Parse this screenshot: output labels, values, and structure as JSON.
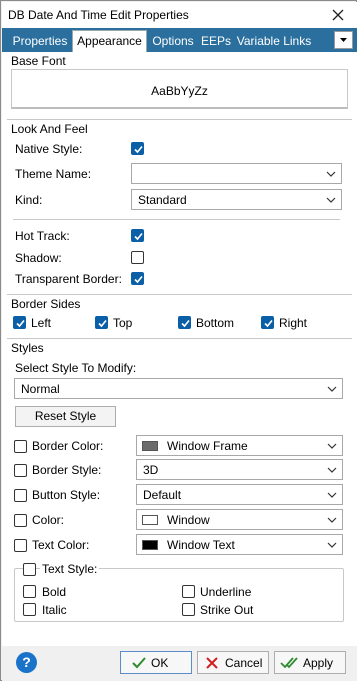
{
  "window": {
    "title": "DB Date And Time Edit Properties"
  },
  "tabs": [
    "Properties",
    "Appearance",
    "Options",
    "EEPs",
    "Variable Links"
  ],
  "base_font": {
    "title": "Base Font",
    "sample": "AaBbYyZz"
  },
  "look_and_feel": {
    "title": "Look And Feel",
    "native_style_label": "Native Style:",
    "native_style_checked": true,
    "theme_name_label": "Theme Name:",
    "theme_name_value": "",
    "kind_label": "Kind:",
    "kind_value": "Standard",
    "hot_track_label": "Hot Track:",
    "hot_track_checked": true,
    "shadow_label": "Shadow:",
    "shadow_checked": false,
    "transparent_border_label": "Transparent Border:",
    "transparent_border_checked": true
  },
  "border_sides": {
    "title": "Border Sides",
    "left": "Left",
    "top": "Top",
    "bottom": "Bottom",
    "right": "Right"
  },
  "styles": {
    "title": "Styles",
    "select_label": "Select Style To Modify:",
    "select_value": "Normal",
    "reset_label": "Reset Style",
    "border_color_label": "Border Color:",
    "border_color_value": "Window Frame",
    "border_color_swatch": "#6b6b6b",
    "border_style_label": "Border Style:",
    "border_style_value": "3D",
    "button_style_label": "Button Style:",
    "button_style_value": "Default",
    "color_label": "Color:",
    "color_value": "Window",
    "color_swatch": "#ffffff",
    "text_color_label": "Text Color:",
    "text_color_value": "Window Text",
    "text_color_swatch": "#000000",
    "text_style_label": "Text Style:",
    "bold": "Bold",
    "italic": "Italic",
    "underline": "Underline",
    "strike_out": "Strike Out"
  },
  "footer": {
    "ok": "OK",
    "cancel": "Cancel",
    "apply": "Apply",
    "help_glyph": "?"
  },
  "colors": {
    "accent": "#0a5fa6",
    "tabbar": "#2b6f9e"
  }
}
